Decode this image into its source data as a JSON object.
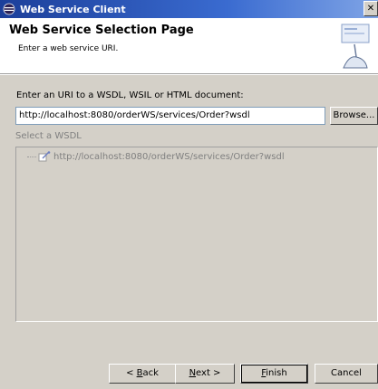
{
  "window": {
    "title": "Web Service Client"
  },
  "header": {
    "title": "Web Service Selection Page",
    "description": "Enter a web service URI."
  },
  "uri": {
    "label": "Enter an URI to a WSDL, WSIL or HTML document:",
    "value": "http://localhost:8080/orderWS/services/Order?wsdl",
    "browse_label": "Browse..."
  },
  "wsdl": {
    "label": "Select a WSDL",
    "items": [
      "http://localhost:8080/orderWS/services/Order?wsdl"
    ]
  },
  "buttons": {
    "back_prefix": "< ",
    "back_key": "B",
    "back_rest": "ack",
    "next_key": "N",
    "next_rest": "ext >",
    "finish_key": "F",
    "finish_rest": "inish",
    "cancel": "Cancel"
  },
  "colors": {
    "titlebar_start": "#1c3f9a",
    "titlebar_end": "#7fa4e6",
    "dialog_bg": "#d4d0c8"
  }
}
